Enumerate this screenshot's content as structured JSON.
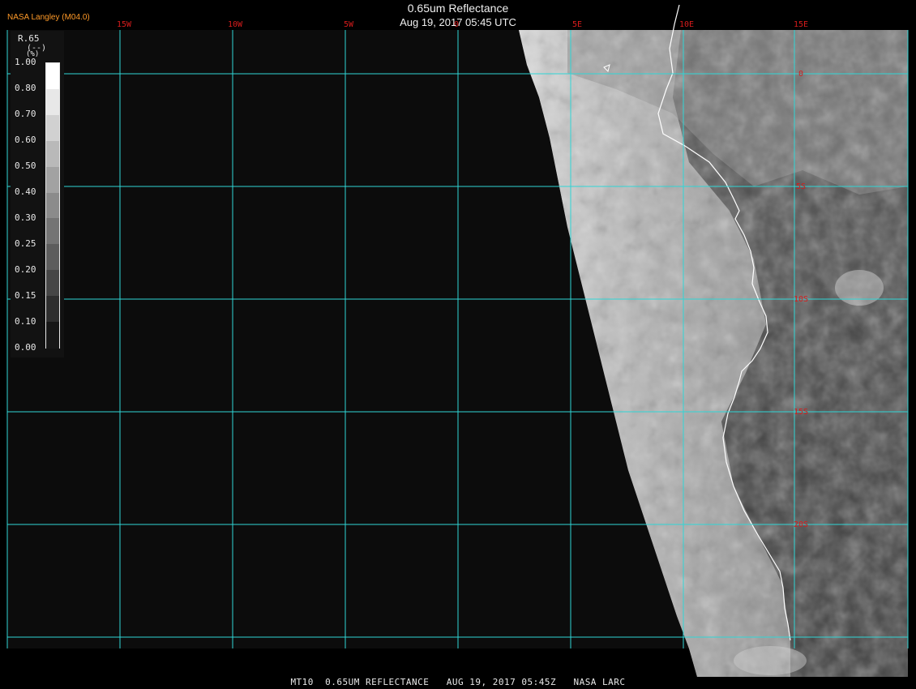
{
  "header": {
    "title": "0.65um Reflectance",
    "subtitle": "Aug 19, 2017 05:45 UTC",
    "producer": "NASA Langley (M04.0)"
  },
  "footer": {
    "text": "MT10  0.65UM REFLECTANCE   AUG 19, 2017 05:45Z   NASA LARC"
  },
  "legend": {
    "variable": "R.65",
    "unit": "(--)",
    "unit_prefix": "(%)",
    "ticks": [
      "1.00",
      "0.80",
      "0.70",
      "0.60",
      "0.50",
      "0.40",
      "0.30",
      "0.25",
      "0.20",
      "0.15",
      "0.10",
      "0.00"
    ]
  },
  "map": {
    "lon_labels": [
      "15W",
      "10W",
      "5W",
      "0",
      "5E",
      "10E",
      "15E"
    ],
    "lat_labels": [
      "0",
      "5S",
      "10S",
      "15S",
      "20S"
    ],
    "grid_color": "#2fd6d6",
    "label_color": "#d81c1c",
    "coast_color": "#ffffff",
    "ocean_color": "#0c0c0c"
  }
}
